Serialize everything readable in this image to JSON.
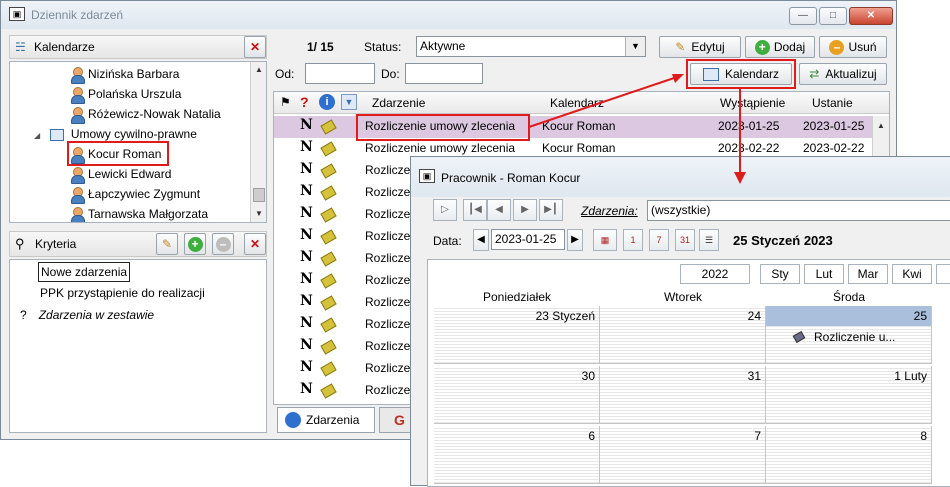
{
  "main_window": {
    "title": "Dziennik zdarzeń",
    "calendars_panel": {
      "title": "Kalendarze",
      "tree": [
        {
          "label": "Nizińska Barbara",
          "type": "person"
        },
        {
          "label": "Polańska Urszula",
          "type": "person"
        },
        {
          "label": "Różewicz-Nowak Natalia",
          "type": "person"
        },
        {
          "label": "Umowy cywilno-prawne",
          "type": "group"
        },
        {
          "label": "Kocur Roman",
          "type": "person",
          "selected": true
        },
        {
          "label": "Lewicki Edward",
          "type": "person"
        },
        {
          "label": "Łapczywiec Zygmunt",
          "type": "person"
        },
        {
          "label": "Tarnawska Małgorzata",
          "type": "person"
        }
      ]
    },
    "criteria_panel": {
      "title": "Kryteria",
      "items": [
        {
          "prefix": "",
          "label": "Nowe zdarzenia"
        },
        {
          "prefix": "",
          "label": "PPK przystąpienie do realizacji"
        },
        {
          "prefix": "?",
          "label": "Zdarzenia w zestawie"
        }
      ]
    },
    "toolbar": {
      "counter": "1/ 15",
      "status_label": "Status:",
      "status_value": "Aktywne",
      "edit_label": "Edytuj",
      "add_label": "Dodaj",
      "delete_label": "Usuń",
      "from_label": "Od:",
      "to_label": "Do:",
      "calendar_label": "Kalendarz",
      "refresh_label": "Aktualizuj"
    },
    "grid": {
      "columns": {
        "flag": "?",
        "event": "Zdarzenie",
        "calendar": "Kalendarz",
        "occurrence": "Wystąpienie",
        "deadline": "Ustanie"
      },
      "rows": [
        {
          "mark": "N",
          "event": "Rozliczenie umowy zlecenia",
          "calendar": "Kocur Roman",
          "occurrence": "2023-01-25",
          "deadline": "2023-01-25"
        },
        {
          "mark": "N",
          "event": "Rozliczenie umowy zlecenia",
          "calendar": "Kocur Roman",
          "occurrence": "2023-02-22",
          "deadline": "2023-02-22"
        },
        {
          "mark": "N",
          "event": "Rozliczenie",
          "calendar": "",
          "occurrence": "",
          "deadline": ""
        },
        {
          "mark": "N",
          "event": "Rozliczenie",
          "calendar": "",
          "occurrence": "",
          "deadline": ""
        },
        {
          "mark": "N",
          "event": "Rozliczenie",
          "calendar": "",
          "occurrence": "",
          "deadline": ""
        },
        {
          "mark": "N",
          "event": "Rozliczenie",
          "calendar": "",
          "occurrence": "",
          "deadline": ""
        },
        {
          "mark": "N",
          "event": "Rozliczenie",
          "calendar": "",
          "occurrence": "",
          "deadline": ""
        },
        {
          "mark": "N",
          "event": "Rozliczenie",
          "calendar": "",
          "occurrence": "",
          "deadline": ""
        },
        {
          "mark": "N",
          "event": "Rozliczenie",
          "calendar": "",
          "occurrence": "",
          "deadline": ""
        },
        {
          "mark": "N",
          "event": "Rozliczenie",
          "calendar": "",
          "occurrence": "",
          "deadline": ""
        },
        {
          "mark": "N",
          "event": "Rozliczenie",
          "calendar": "",
          "occurrence": "",
          "deadline": ""
        },
        {
          "mark": "N",
          "event": "Rozliczenie",
          "calendar": "",
          "occurrence": "",
          "deadline": ""
        },
        {
          "mark": "N",
          "event": "Rozliczenie",
          "calendar": "",
          "occurrence": "",
          "deadline": ""
        }
      ]
    },
    "tabs": [
      {
        "label": "Zdarzenia"
      },
      {
        "label": ""
      }
    ]
  },
  "calendar_window": {
    "title": "Pracownik - Roman Kocur",
    "events_label": "Zdarzenia:",
    "events_value": "(wszystkie)",
    "date_label": "Data:",
    "date_value": "2023-01-25",
    "date_display": "25 Styczeń 2023",
    "period_buttons": [
      "2022",
      "Sty",
      "Lut",
      "Mar",
      "Kwi",
      "M"
    ],
    "weekdays": [
      "Poniedziałek",
      "Wtorek",
      "Środa"
    ],
    "weeks": [
      [
        "23 Styczeń",
        "24",
        "25"
      ],
      [
        "30",
        "31",
        "1 Luty"
      ],
      [
        "6",
        "7",
        "8"
      ]
    ],
    "event_text": "Rozliczenie u..."
  },
  "colors": {
    "highlight": "#e01b1b",
    "selected_row": "#dcc8e0",
    "selected_day": "#a9bfdc"
  }
}
